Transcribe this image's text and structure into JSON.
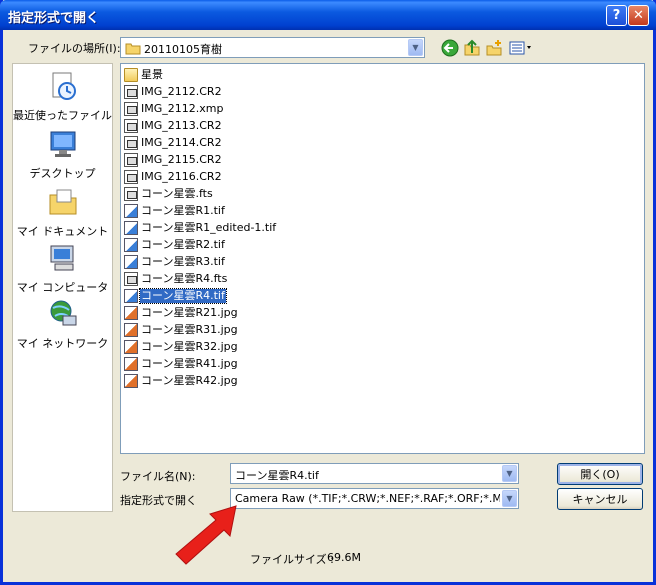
{
  "window": {
    "title": "指定形式で開く",
    "help_glyph": "?",
    "close_glyph": "✕"
  },
  "look_in": {
    "label": "ファイルの場所(I):",
    "value": "20110105育樹"
  },
  "toolbar": {
    "icons": [
      "back-icon",
      "up-folder-icon",
      "new-folder-icon",
      "view-menu-icon"
    ]
  },
  "places": [
    {
      "label": "最近使ったファイル",
      "icon": "recent-files-icon"
    },
    {
      "label": "デスクトップ",
      "icon": "desktop-icon"
    },
    {
      "label": "マイ ドキュメント",
      "icon": "my-documents-icon"
    },
    {
      "label": "マイ コンピュータ",
      "icon": "my-computer-icon"
    },
    {
      "label": "マイ ネットワーク",
      "icon": "my-network-icon"
    }
  ],
  "files": [
    {
      "name": "星景",
      "type": "folder"
    },
    {
      "name": "IMG_2112.CR2",
      "type": "raw"
    },
    {
      "name": "IMG_2112.xmp",
      "type": "raw"
    },
    {
      "name": "IMG_2113.CR2",
      "type": "raw"
    },
    {
      "name": "IMG_2114.CR2",
      "type": "raw"
    },
    {
      "name": "IMG_2115.CR2",
      "type": "raw"
    },
    {
      "name": "IMG_2116.CR2",
      "type": "raw"
    },
    {
      "name": "コーン星雲.fts",
      "type": "raw"
    },
    {
      "name": "コーン星雲R1.tif",
      "type": "tif"
    },
    {
      "name": "コーン星雲R1_edited-1.tif",
      "type": "tif"
    },
    {
      "name": "コーン星雲R2.tif",
      "type": "tif"
    },
    {
      "name": "コーン星雲R3.tif",
      "type": "tif"
    },
    {
      "name": "コーン星雲R4.fts",
      "type": "raw"
    },
    {
      "name": "コーン星雲R4.tif",
      "type": "tif",
      "selected": true
    },
    {
      "name": "コーン星雲R21.jpg",
      "type": "jpg"
    },
    {
      "name": "コーン星雲R31.jpg",
      "type": "jpg"
    },
    {
      "name": "コーン星雲R32.jpg",
      "type": "jpg"
    },
    {
      "name": "コーン星雲R41.jpg",
      "type": "jpg"
    },
    {
      "name": "コーン星雲R42.jpg",
      "type": "jpg"
    }
  ],
  "filename": {
    "label": "ファイル名(N):",
    "value": "コーン星雲R4.tif"
  },
  "format": {
    "label": "指定形式で開く",
    "value": "Camera Raw (*.TIF;*.CRW;*.NEF;*.RAF;*.ORF;*.MRW"
  },
  "buttons": {
    "open": "開く(O)",
    "cancel": "キャンセル"
  },
  "file_size": {
    "label": "ファイルサイズ :",
    "value": "69.6M"
  },
  "annotation": {
    "arrow_color": "#e8201a",
    "icon": "red-arrow-icon"
  }
}
